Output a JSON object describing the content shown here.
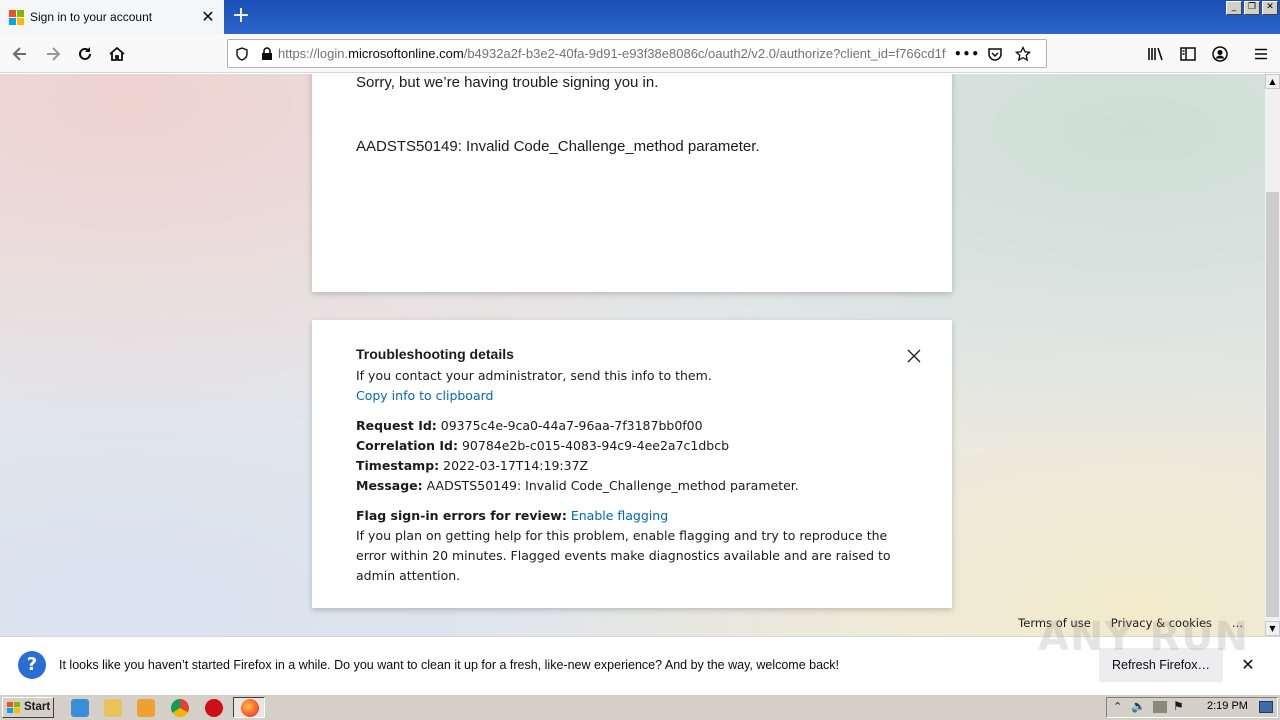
{
  "tab": {
    "title": "Sign in to your account"
  },
  "window_controls": {
    "minimize": "_",
    "restore": "❐",
    "close": "✕"
  },
  "urlbar": {
    "prefix": "https://login.",
    "domain": "microsoftonline.com",
    "path": "/b4932a2f-b3e2-40fa-9d91-e93f38e8086c/oauth2/v2.0/authorize?client_id=f766cd1f"
  },
  "error_card": {
    "line1": "Sorry, but we’re having trouble signing you in.",
    "line2": "AADSTS50149: Invalid Code_Challenge_method parameter."
  },
  "troubleshooting": {
    "title": "Troubleshooting details",
    "subtitle": "If you contact your administrator, send this info to them.",
    "copy_link": "Copy info to clipboard",
    "request_id_label": "Request Id:",
    "request_id": "09375c4e-9ca0-44a7-96aa-7f3187bb0f00",
    "correlation_id_label": "Correlation Id:",
    "correlation_id": "90784e2b-c015-4083-94c9-4ee2a7c1dbcb",
    "timestamp_label": "Timestamp:",
    "timestamp": "2022-03-17T14:19:37Z",
    "message_label": "Message:",
    "message": "AADSTS50149: Invalid Code_Challenge_method parameter.",
    "flag_label": "Flag sign-in errors for review:",
    "flag_link": "Enable flagging",
    "flag_text": "If you plan on getting help for this problem, enable flagging and try to reproduce the error within 20 minutes. Flagged events make diagnostics available and are raised to admin attention."
  },
  "footer": {
    "terms": "Terms of use",
    "privacy": "Privacy & cookies",
    "more": "..."
  },
  "notification": {
    "text": "It looks like you haven’t started Firefox in a while. Do you want to clean it up for a fresh, like-new experience? And by the way, welcome back!",
    "button": "Refresh Firefox…"
  },
  "taskbar": {
    "start": "Start",
    "clock": "2:19 PM"
  },
  "watermark": "ANY RUN",
  "colors": {
    "link": "#0067b8",
    "titlebar": "#2e66cc",
    "notify_icon": "#2b6cd6"
  }
}
